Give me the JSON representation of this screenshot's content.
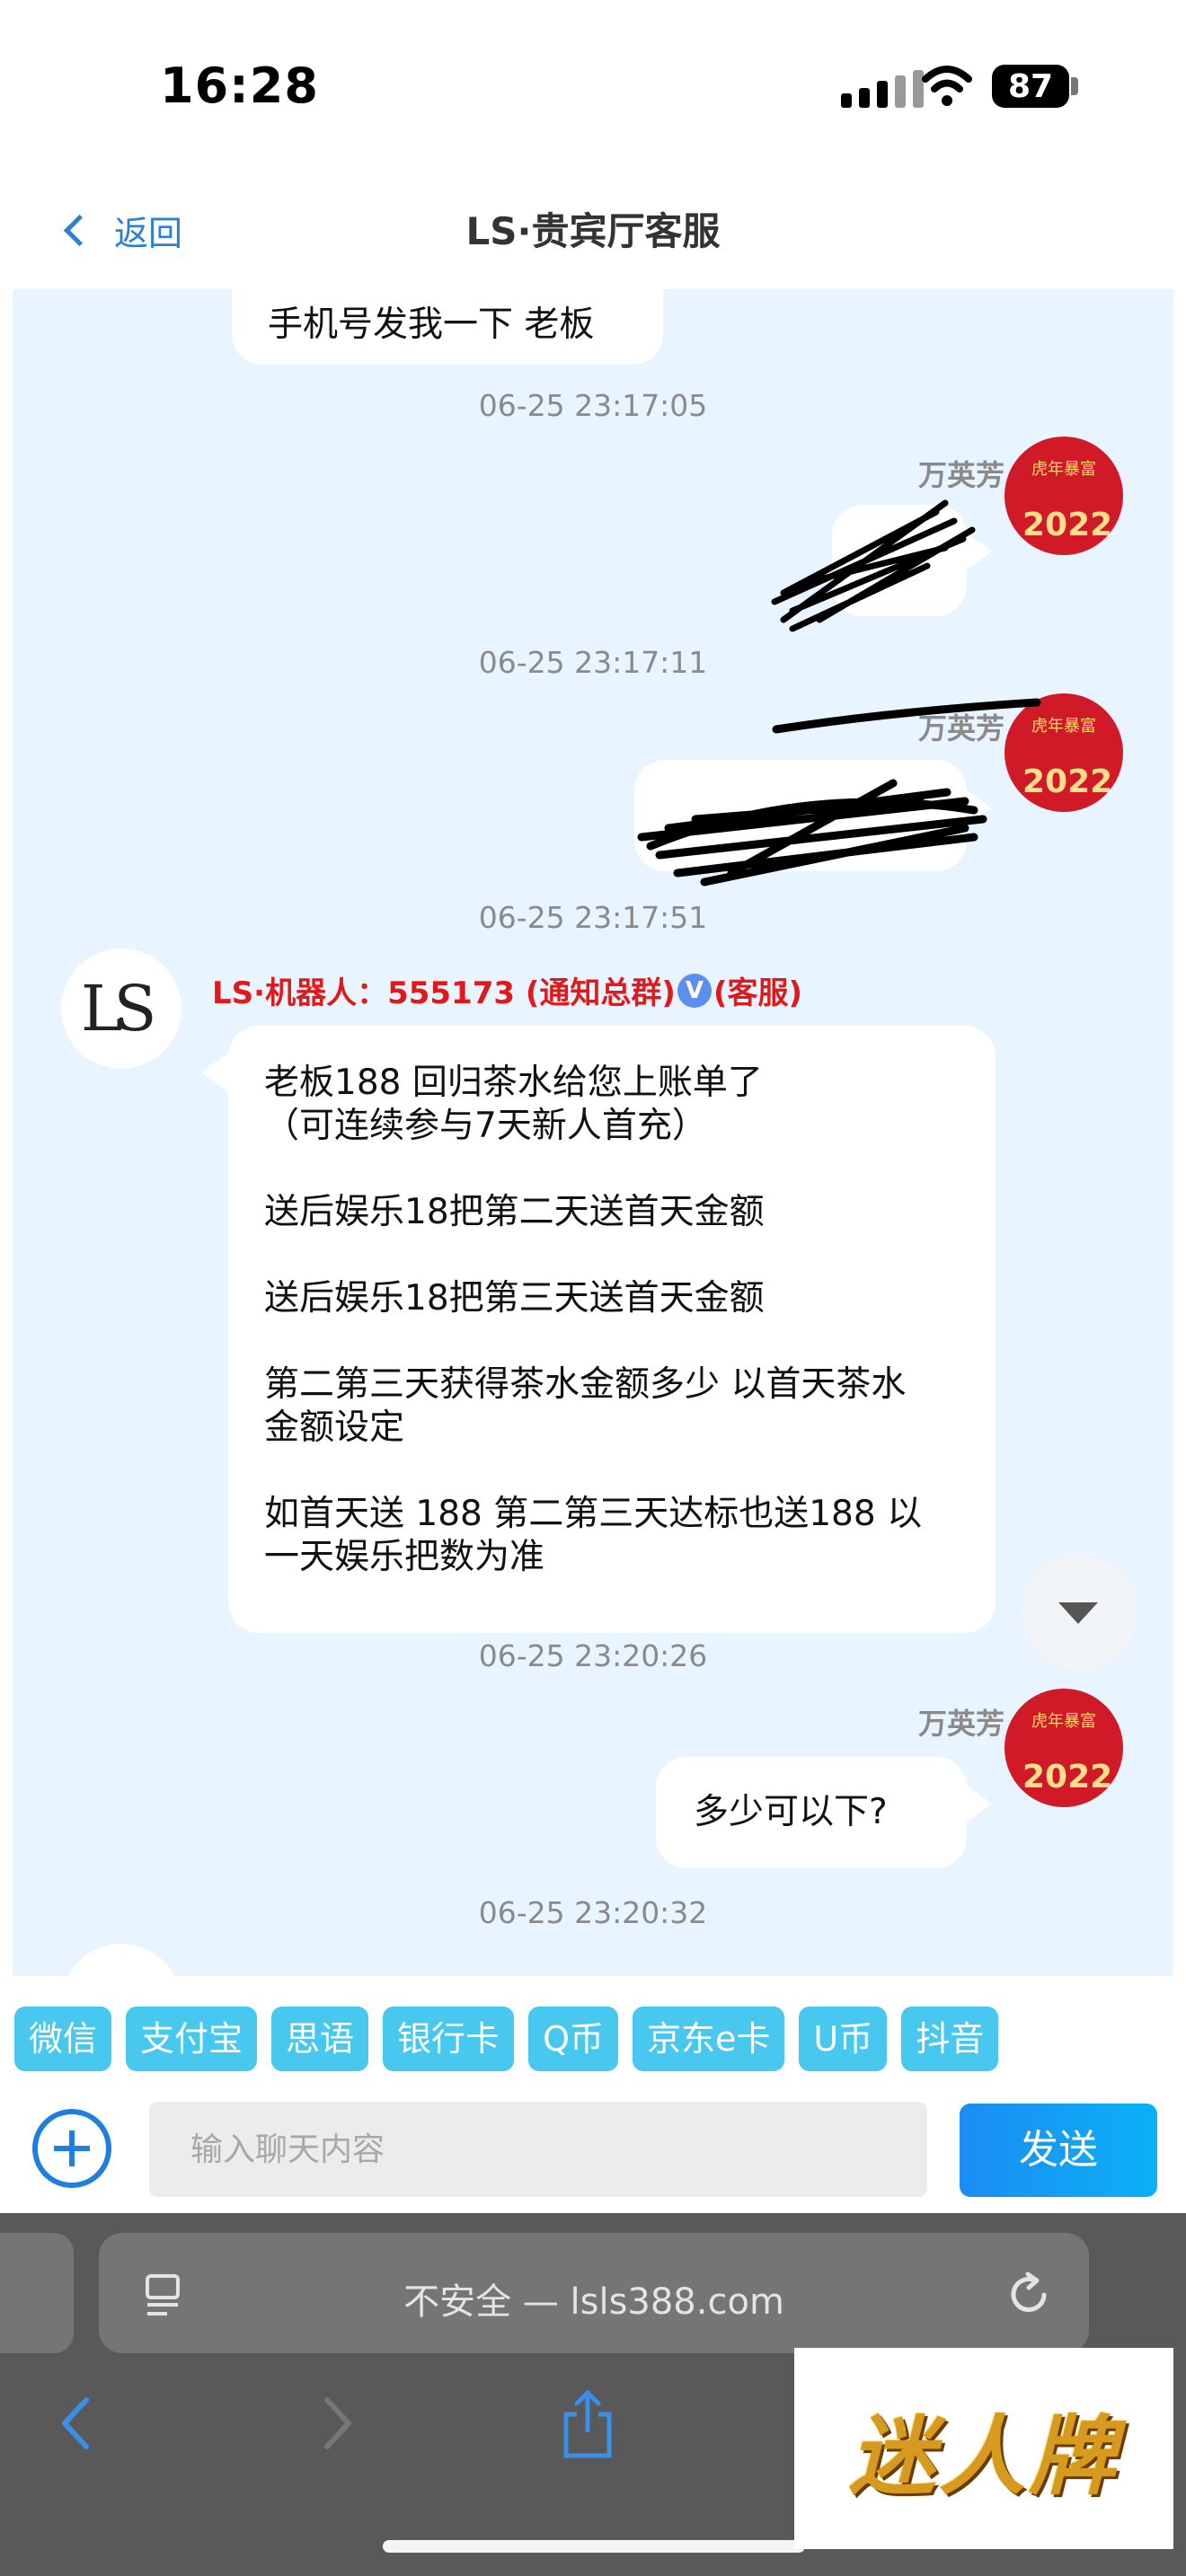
{
  "status_bar": {
    "time": "16:28",
    "battery": "87"
  },
  "nav": {
    "back_label": "返回",
    "title": "LS·贵宾厅客服"
  },
  "chat": {
    "messages": [
      {
        "text": "手机号发我一下 老板"
      },
      {
        "timestamp": "06-25 23:17:05"
      },
      {
        "sender": "万英芳",
        "text": ""
      },
      {
        "timestamp": "06-25 23:17:11"
      },
      {
        "sender": "万英芳",
        "text": ""
      },
      {
        "timestamp": "06-25 23:17:51"
      },
      {
        "sender": "LS·机器人：555173 (通知总群)",
        "sender_suffix": "(客服)",
        "verified_badge": "V",
        "avatar_text": "LS",
        "lines": [
          "老板188 回归茶水给您上账单了",
          "（可连续参与7天新人首充）",
          "送后娱乐18把第二天送首天金额",
          "送后娱乐18把第三天送首天金额",
          "第二第三天获得茶水金额多少 以首天茶水",
          "金额设定",
          "如首天送 188 第二第三天达标也送188 以",
          "一天娱乐把数为准"
        ]
      },
      {
        "timestamp": "06-25 23:20:26"
      },
      {
        "sender": "万英芳",
        "text": "多少可以下?"
      },
      {
        "timestamp": "06-25 23:20:32"
      }
    ],
    "avatar_year": "2022",
    "avatar_caption": "虎年暴富"
  },
  "quick_tags": [
    "微信",
    "支付宝",
    "思语",
    "银行卡",
    "Q币",
    "京东e卡",
    "U币",
    "抖音"
  ],
  "composer": {
    "placeholder": "输入聊天内容",
    "send_label": "发送"
  },
  "browser": {
    "url_text": "不安全 — lsls388.com"
  },
  "watermark": {
    "text": "迷人牌"
  },
  "colors": {
    "accent_blue": "#1e7fe0",
    "tag_cyan": "#48c8ee",
    "bot_name_red": "#e01a1a",
    "chat_bg": "#e8f4ff",
    "avatar_red": "#d01a28"
  }
}
